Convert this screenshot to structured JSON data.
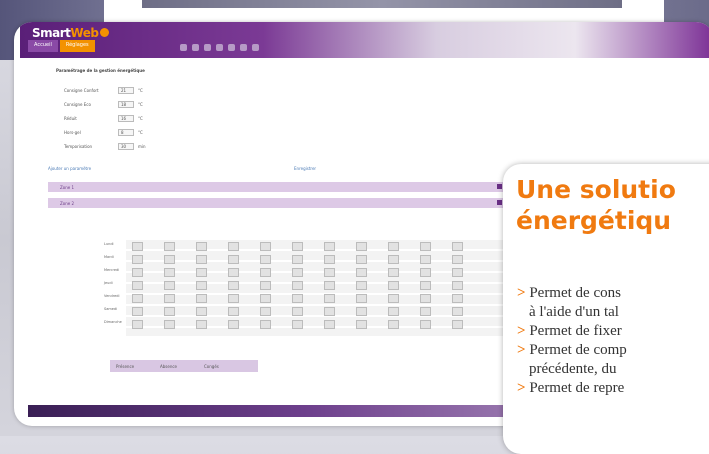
{
  "app": {
    "logo_text": "Smart",
    "logo_accent": "Web",
    "tabs": [
      "Accueil",
      "Réglages"
    ]
  },
  "panel": {
    "heading": "Paramétrage de la gestion énergétique",
    "fields": [
      {
        "label": "Consigne Confort",
        "value": "21",
        "unit": "°C"
      },
      {
        "label": "Consigne Eco",
        "value": "18",
        "unit": "°C"
      },
      {
        "label": "Réduit",
        "value": "16",
        "unit": "°C"
      },
      {
        "label": "Hors-gel",
        "value": "8",
        "unit": "°C"
      },
      {
        "label": "Temporisation",
        "value": "30",
        "unit": "min"
      }
    ],
    "link_left": "Ajouter un paramètre",
    "link_right": "Enregistrer",
    "sections": [
      "Zone 1",
      "Zone 2"
    ]
  },
  "schedule": {
    "days": [
      "Lundi",
      "Mardi",
      "Mercredi",
      "Jeudi",
      "Vendredi",
      "Samedi",
      "Dimanche"
    ],
    "day_tabs": [
      "Présence",
      "Absence",
      "Congés"
    ]
  },
  "callout": {
    "title_lines": [
      "Une solutio",
      "énergétiqu"
    ],
    "bullets": [
      "Permet de cons",
      "à l'aide d'un tal",
      "Permet de  fixer",
      "Permet de comp",
      "précédente, du",
      "Permet de repre"
    ]
  },
  "colors": {
    "accent": "#f07a10",
    "brand": "#6a2f87"
  }
}
